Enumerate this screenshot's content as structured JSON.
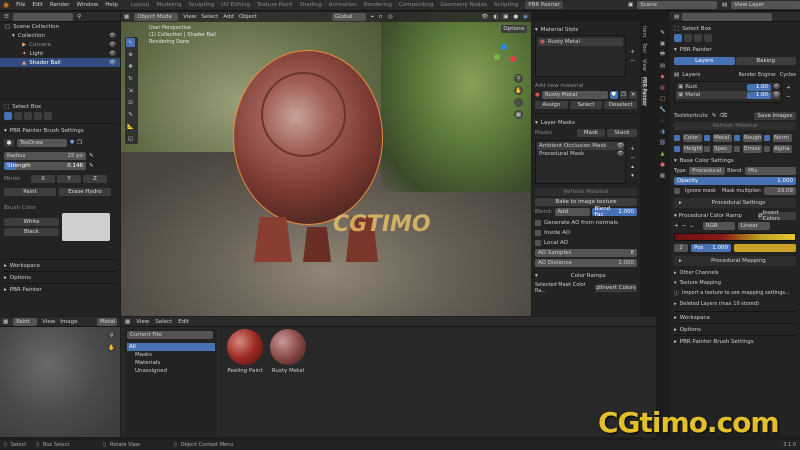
{
  "topbar": {
    "menus": [
      "File",
      "Edit",
      "Render",
      "Window",
      "Help"
    ],
    "workspaces": [
      "Layout",
      "Modeling",
      "Sculpting",
      "UV Editing",
      "Texture Paint",
      "Shading",
      "Animation",
      "Rendering",
      "Compositing",
      "Geometry Nodes",
      "Scripting",
      "PBR Painter"
    ],
    "scene": "Scene",
    "view_layer": "View Layer"
  },
  "outliner": {
    "root": "Scene Collection",
    "collection": "Collection",
    "items": [
      "Camera",
      "Light",
      "Shader Ball"
    ]
  },
  "brush_panel": {
    "tool": "Select Box",
    "section": "PBR Painter Brush Settings",
    "brush": "TexDraw",
    "radius_label": "Radius",
    "radius": "25 px",
    "strength_label": "Strength",
    "strength": "0.146",
    "mirror": "Mirror",
    "x": "X",
    "y": "Y",
    "z": "Z",
    "paint": "Paint",
    "erase": "Erase Hydro",
    "brush_color": "Brush Color",
    "white": "White",
    "black": "Black",
    "collapsed": [
      "Workspace",
      "Options",
      "PBR Painter"
    ]
  },
  "viewport": {
    "mode": "Object Mode",
    "menus": [
      "View",
      "Select",
      "Add",
      "Object"
    ],
    "info": [
      "User Perspective",
      "(1) Collection | Shader Ball",
      "Rendering Done"
    ],
    "orientation": "Global",
    "options": "Options",
    "watermark": "CGTIMO"
  },
  "material_panel": {
    "title": "Material Slots",
    "slot": "Rusty Metal",
    "add_label": "Add new material",
    "mat_name": "Rusty Metal",
    "assign": "Assign",
    "select": "Select",
    "deselect": "Deselect",
    "layer_masks": "Layer Masks",
    "masks_label": "Masks",
    "mask_btn": "Mask",
    "stack_btn": "Stack",
    "masks": [
      "Ambient Occlusion Mask",
      "Procedural Mask"
    ],
    "refresh": "Refresh Material",
    "bake": "Bake to image texture",
    "blend_label": "Blend:",
    "blend": "Add",
    "blend_factor_label": "Blend Fac",
    "blend_factor": "1.000",
    "options": [
      "Generate AO from normals",
      "Inside AO",
      "Local AO"
    ],
    "ao_samples_label": "AO Samples",
    "ao_samples": "8",
    "ao_distance_label": "AO Distance",
    "ao_distance": "1.000",
    "color_ramps": "Color Ramps",
    "selected_mask": "Selected Mask Color Ra...",
    "invert": "Invert Colors"
  },
  "properties": {
    "tool": "Select Box",
    "addon": "PBR Painter",
    "tabs": [
      "Layers",
      "Baking"
    ],
    "layers_label": "Layers",
    "render_engine_label": "Render Engine:",
    "render_engine": "Cycles",
    "layers": [
      {
        "name": "Rust",
        "value": "1.00"
      },
      {
        "name": "Metal",
        "value": "1.00"
      }
    ],
    "toolshortcuts": "Toolshortcuts:",
    "save_images": "Save Images",
    "refresh_material": "Refresh Material",
    "channels": [
      "Color",
      "Metal",
      "Rough",
      "Norm",
      "Height",
      "Spec",
      "Emiss",
      "Alpha"
    ],
    "base_color": "Base Color Settings",
    "type_label": "Type:",
    "type": "Procedural",
    "blend_label": "Blend:",
    "blend": "Mix",
    "opacity_label": "Opacity",
    "opacity": "1.000",
    "ignore_mask": "Ignore mask",
    "mask_multiplier_label": "Mask multiplier:",
    "mask_multiplier": "19.09",
    "proc_settings": "Procedural Settings",
    "ramp": "Procedural Color Ramp",
    "invert": "Invert Colors",
    "ramp_mode": "RGB",
    "ramp_interp": "Linear",
    "ramp_index": "2",
    "pos_label": "Pos",
    "pos": "1.000",
    "proc_mapping": "Procedural Mapping",
    "other_channels": "Other Channels",
    "texture_mapping": "Texture Mapping",
    "import_hint": "Import a texture to see mapping settings...",
    "deleted": "Deleted Layers (max 10 stored)",
    "collapsed": [
      "Workspace",
      "Options",
      "PBR Painter Brush Settings"
    ],
    "side_tabs": [
      "Item",
      "Tool",
      "View",
      "PBR Painter"
    ]
  },
  "image_editor": {
    "mode": "Paint",
    "menus": [
      "View",
      "Image"
    ],
    "name": "Metal"
  },
  "asset_browser": {
    "menus": [
      "View",
      "Select",
      "Edit"
    ],
    "library": "Current File",
    "categories": [
      "All",
      "Masks",
      "Materials",
      "Unassigned"
    ],
    "assets": [
      "Peeling Paint",
      "Rusty Metal"
    ]
  },
  "statusbar": {
    "select": "Select",
    "box_select": "Box Select",
    "rotate": "Rotate View",
    "context": "Object Context Menu",
    "version": "3.1.0"
  },
  "brand_watermark": "CGtimo.com",
  "colors": {
    "accent": "#4772b3",
    "header": "#2b2b2b",
    "panel": "#232323"
  }
}
